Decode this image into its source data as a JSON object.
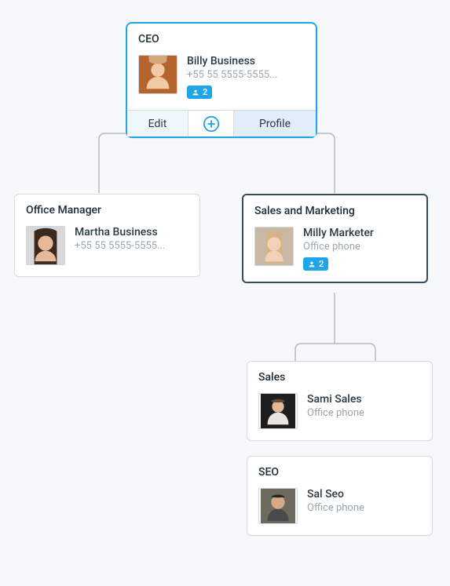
{
  "cards": {
    "ceo": {
      "role": "CEO",
      "name": "Billy Business",
      "detail": "+55 55 5555-5555...",
      "badge_count": "2"
    },
    "office_manager": {
      "role": "Office Manager",
      "name": "Martha Business",
      "detail": "+55 55 5555-5555..."
    },
    "sales_marketing": {
      "role": "Sales and Marketing",
      "name": "Milly Marketer",
      "detail": "Office phone",
      "badge_count": "2"
    },
    "sales": {
      "role": "Sales",
      "name": "Sami Sales",
      "detail": "Office phone"
    },
    "seo": {
      "role": "SEO",
      "name": "Sal Seo",
      "detail": "Office phone"
    }
  },
  "actions": {
    "edit": "Edit",
    "profile": "Profile"
  },
  "colors": {
    "accent": "#1fa5ea",
    "text": "#1c2b36",
    "muted": "#9aa7b0",
    "border": "#d6dde3"
  }
}
